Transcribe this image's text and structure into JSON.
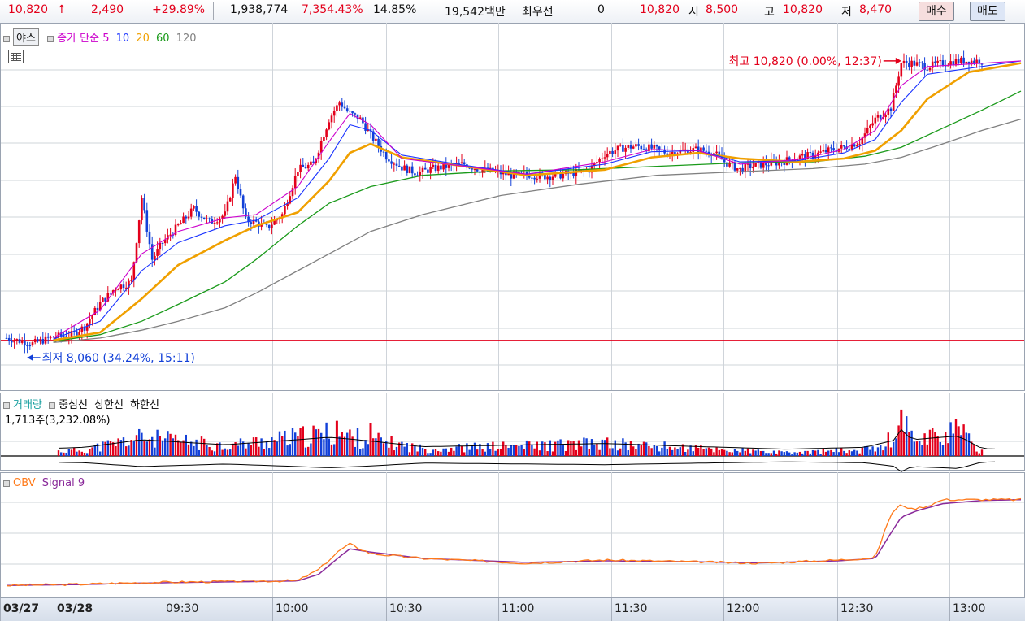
{
  "quote": {
    "price": "10,820",
    "arrow": "↑",
    "change": "2,490",
    "change_pct": "+29.89%",
    "volume": "1,938,774",
    "volume_ratio": "7,354.43%",
    "turnover": "14.85%",
    "amount": "19,542백만",
    "best_label": "최우선",
    "best_value": "0",
    "best_price": "10,820",
    "open_label": "시",
    "open": "8,500",
    "high_label": "고",
    "high": "10,820",
    "low_label": "저",
    "low": "8,470",
    "buy_label": "매수",
    "sell_label": "매도"
  },
  "legend": {
    "night_label": "야스",
    "ma_title": "종가 단순",
    "ma_periods": [
      "5",
      "10",
      "20",
      "60",
      "120"
    ],
    "vol_title": "거래량",
    "vol_sub": "중심선",
    "vol_upper": "상한선",
    "vol_lower": "하한선",
    "vol_value": "1,713주(3,232.08%)",
    "obv_title": "OBV",
    "obv_signal": "Signal 9"
  },
  "annotations": {
    "high": "최고 10,820 (0.00%, 12:37)",
    "low": "최저 8,060 (34.24%, 15:11)"
  },
  "colors": {
    "up": "#e3001b",
    "down": "#1240d8",
    "ma5": "#cc00cc",
    "ma10": "#1a33ff",
    "ma20": "#f0a000",
    "ma60": "#1a9a1a",
    "ma120": "#808080",
    "obv": "#ff7a1a",
    "signal": "#8a2a9a"
  },
  "chart_data": {
    "type": "candlestick",
    "x_ticks": [
      "03/27",
      "03/28",
      "09:30",
      "10:00",
      "10:30",
      "11:00",
      "11:30",
      "12:00",
      "12:30",
      "13:00"
    ],
    "ylim": [
      7900,
      11000
    ],
    "prev_close": 8330,
    "price_path": [
      [
        0,
        8350
      ],
      [
        10,
        8300
      ],
      [
        18,
        8360
      ],
      [
        25,
        8380
      ],
      [
        30,
        8450
      ],
      [
        36,
        8660
      ],
      [
        42,
        8800
      ],
      [
        48,
        8850
      ],
      [
        52,
        9600
      ],
      [
        56,
        9050
      ],
      [
        60,
        9200
      ],
      [
        66,
        9350
      ],
      [
        72,
        9500
      ],
      [
        78,
        9380
      ],
      [
        84,
        9450
      ],
      [
        88,
        9800
      ],
      [
        92,
        9400
      ],
      [
        96,
        9380
      ],
      [
        100,
        9330
      ],
      [
        106,
        9450
      ],
      [
        112,
        9850
      ],
      [
        118,
        9900
      ],
      [
        124,
        10300
      ],
      [
        128,
        10450
      ],
      [
        132,
        10350
      ],
      [
        136,
        10300
      ],
      [
        140,
        10160
      ],
      [
        146,
        9970
      ],
      [
        152,
        9870
      ],
      [
        158,
        9820
      ],
      [
        164,
        9860
      ],
      [
        170,
        9880
      ],
      [
        176,
        9900
      ],
      [
        182,
        9850
      ],
      [
        188,
        9830
      ],
      [
        194,
        9800
      ],
      [
        200,
        9810
      ],
      [
        206,
        9790
      ],
      [
        212,
        9800
      ],
      [
        218,
        9820
      ],
      [
        224,
        9850
      ],
      [
        230,
        9990
      ],
      [
        236,
        10040
      ],
      [
        242,
        10060
      ],
      [
        248,
        10040
      ],
      [
        254,
        10000
      ],
      [
        260,
        10020
      ],
      [
        266,
        10030
      ],
      [
        272,
        10000
      ],
      [
        276,
        9920
      ],
      [
        282,
        9850
      ],
      [
        286,
        9880
      ],
      [
        292,
        9900
      ],
      [
        298,
        9920
      ],
      [
        304,
        9960
      ],
      [
        310,
        9980
      ],
      [
        316,
        10020
      ],
      [
        322,
        10050
      ],
      [
        328,
        10100
      ],
      [
        334,
        10300
      ],
      [
        340,
        10400
      ],
      [
        344,
        10800
      ],
      [
        348,
        10800
      ],
      [
        354,
        10770
      ],
      [
        360,
        10800
      ],
      [
        366,
        10820
      ],
      [
        375,
        10820
      ],
      [
        390,
        10820
      ]
    ],
    "ma": {
      "ma5": [
        [
          18,
          8350
        ],
        [
          36,
          8600
        ],
        [
          52,
          9100
        ],
        [
          66,
          9300
        ],
        [
          84,
          9420
        ],
        [
          96,
          9450
        ],
        [
          112,
          9700
        ],
        [
          124,
          10100
        ],
        [
          132,
          10350
        ],
        [
          140,
          10250
        ],
        [
          152,
          9950
        ],
        [
          176,
          9880
        ],
        [
          200,
          9810
        ],
        [
          230,
          9920
        ],
        [
          248,
          10030
        ],
        [
          266,
          10020
        ],
        [
          282,
          9900
        ],
        [
          304,
          9940
        ],
        [
          322,
          10030
        ],
        [
          334,
          10200
        ],
        [
          344,
          10600
        ],
        [
          354,
          10770
        ],
        [
          390,
          10820
        ]
      ],
      "ma10": [
        [
          18,
          8340
        ],
        [
          36,
          8500
        ],
        [
          52,
          8950
        ],
        [
          66,
          9200
        ],
        [
          84,
          9350
        ],
        [
          96,
          9400
        ],
        [
          112,
          9600
        ],
        [
          124,
          9950
        ],
        [
          132,
          10250
        ],
        [
          140,
          10200
        ],
        [
          152,
          9980
        ],
        [
          176,
          9890
        ],
        [
          200,
          9810
        ],
        [
          230,
          9900
        ],
        [
          248,
          10010
        ],
        [
          266,
          10020
        ],
        [
          282,
          9920
        ],
        [
          304,
          9930
        ],
        [
          322,
          10000
        ],
        [
          334,
          10120
        ],
        [
          344,
          10450
        ],
        [
          354,
          10700
        ],
        [
          390,
          10820
        ]
      ],
      "ma20": [
        [
          18,
          8330
        ],
        [
          36,
          8400
        ],
        [
          52,
          8700
        ],
        [
          66,
          9000
        ],
        [
          84,
          9220
        ],
        [
          96,
          9350
        ],
        [
          112,
          9470
        ],
        [
          124,
          9750
        ],
        [
          132,
          10000
        ],
        [
          140,
          10080
        ],
        [
          152,
          9960
        ],
        [
          176,
          9880
        ],
        [
          200,
          9800
        ],
        [
          230,
          9850
        ],
        [
          248,
          9960
        ],
        [
          266,
          10000
        ],
        [
          282,
          9950
        ],
        [
          304,
          9920
        ],
        [
          322,
          9950
        ],
        [
          334,
          10020
        ],
        [
          344,
          10200
        ],
        [
          354,
          10480
        ],
        [
          370,
          10720
        ],
        [
          390,
          10800
        ]
      ],
      "ma60": [
        [
          18,
          8320
        ],
        [
          36,
          8380
        ],
        [
          52,
          8500
        ],
        [
          66,
          8650
        ],
        [
          84,
          8850
        ],
        [
          96,
          9050
        ],
        [
          112,
          9350
        ],
        [
          124,
          9550
        ],
        [
          140,
          9700
        ],
        [
          160,
          9800
        ],
        [
          190,
          9840
        ],
        [
          220,
          9850
        ],
        [
          250,
          9880
        ],
        [
          280,
          9910
        ],
        [
          310,
          9920
        ],
        [
          330,
          9970
        ],
        [
          344,
          10050
        ],
        [
          360,
          10220
        ],
        [
          375,
          10380
        ],
        [
          390,
          10550
        ]
      ],
      "ma120": [
        [
          18,
          8310
        ],
        [
          36,
          8350
        ],
        [
          52,
          8420
        ],
        [
          66,
          8500
        ],
        [
          84,
          8620
        ],
        [
          96,
          8750
        ],
        [
          112,
          8950
        ],
        [
          124,
          9100
        ],
        [
          140,
          9300
        ],
        [
          160,
          9450
        ],
        [
          190,
          9620
        ],
        [
          220,
          9720
        ],
        [
          250,
          9800
        ],
        [
          280,
          9830
        ],
        [
          310,
          9860
        ],
        [
          330,
          9900
        ],
        [
          344,
          9960
        ],
        [
          360,
          10080
        ],
        [
          375,
          10200
        ],
        [
          390,
          10300
        ]
      ]
    },
    "volume_path": [
      [
        0,
        100
      ],
      [
        30,
        300
      ],
      [
        52,
        900
      ],
      [
        84,
        500
      ],
      [
        112,
        900
      ],
      [
        124,
        1100
      ],
      [
        140,
        800
      ],
      [
        160,
        350
      ],
      [
        230,
        600
      ],
      [
        260,
        400
      ],
      [
        300,
        150
      ],
      [
        330,
        300
      ],
      [
        342,
        900
      ],
      [
        344,
        1713
      ],
      [
        348,
        900
      ],
      [
        366,
        1200
      ],
      [
        375,
        200
      ],
      [
        390,
        100
      ]
    ],
    "obv_ylim": [
      -50000,
      600000
    ],
    "obv": [
      [
        0,
        0
      ],
      [
        30,
        8000
      ],
      [
        52,
        18000
      ],
      [
        84,
        25000
      ],
      [
        112,
        30000
      ],
      [
        120,
        100000
      ],
      [
        128,
        220000
      ],
      [
        132,
        260000
      ],
      [
        136,
        230000
      ],
      [
        140,
        200000
      ],
      [
        160,
        170000
      ],
      [
        200,
        140000
      ],
      [
        230,
        160000
      ],
      [
        260,
        150000
      ],
      [
        290,
        140000
      ],
      [
        320,
        160000
      ],
      [
        334,
        175000
      ],
      [
        340,
        450000
      ],
      [
        344,
        510000
      ],
      [
        348,
        480000
      ],
      [
        354,
        500000
      ],
      [
        360,
        540000
      ],
      [
        375,
        540000
      ],
      [
        390,
        540000
      ]
    ],
    "signal": [
      [
        0,
        0
      ],
      [
        30,
        6000
      ],
      [
        52,
        15000
      ],
      [
        84,
        22000
      ],
      [
        112,
        28000
      ],
      [
        120,
        70000
      ],
      [
        128,
        180000
      ],
      [
        132,
        230000
      ],
      [
        140,
        210000
      ],
      [
        160,
        170000
      ],
      [
        200,
        145000
      ],
      [
        230,
        155000
      ],
      [
        260,
        150000
      ],
      [
        290,
        142000
      ],
      [
        320,
        155000
      ],
      [
        334,
        170000
      ],
      [
        340,
        330000
      ],
      [
        344,
        430000
      ],
      [
        350,
        470000
      ],
      [
        360,
        515000
      ],
      [
        375,
        535000
      ],
      [
        390,
        540000
      ]
    ]
  }
}
